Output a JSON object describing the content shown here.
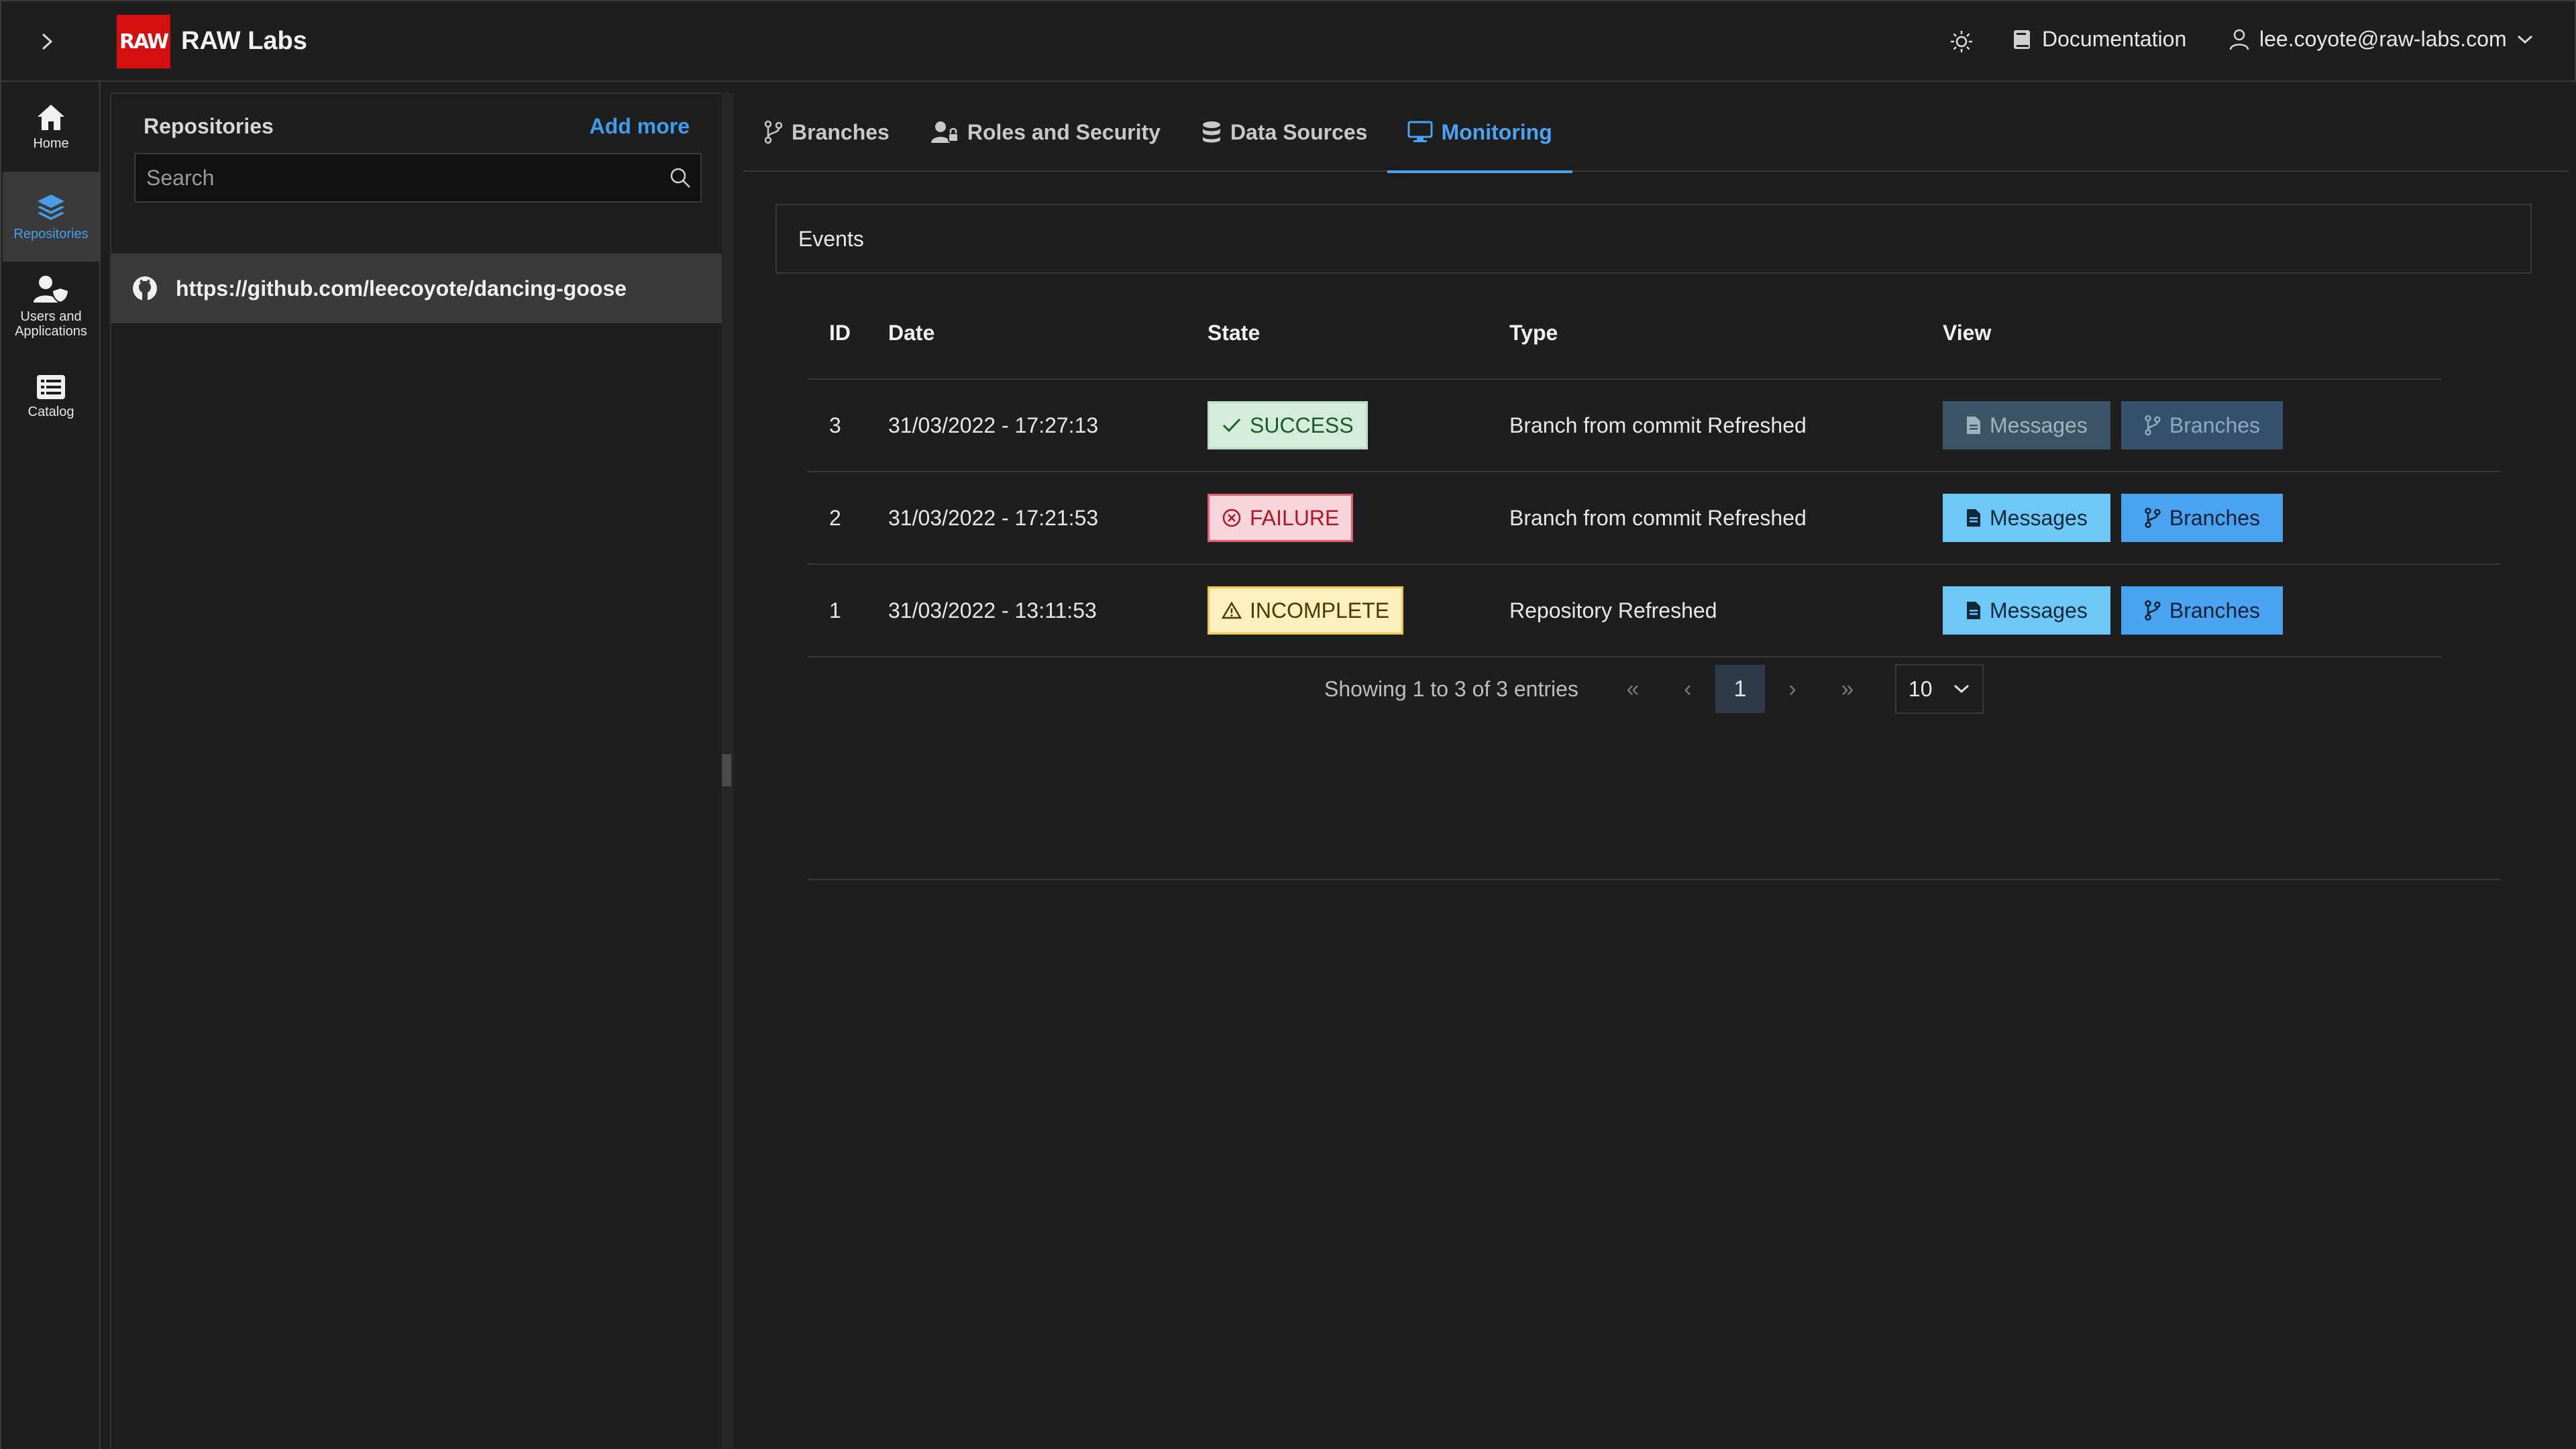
{
  "app": {
    "logo_text": "RAW",
    "brand": "RAW Labs"
  },
  "header": {
    "documentation": "Documentation",
    "user_email": "lee.coyote@raw-labs.com"
  },
  "rail": {
    "items": [
      {
        "label": "Home",
        "icon": "home-icon"
      },
      {
        "label": "Repositories",
        "icon": "layers-icon",
        "active": true
      },
      {
        "label": "Users and Applications",
        "icon": "user-shield-icon"
      },
      {
        "label": "Catalog",
        "icon": "list-icon"
      }
    ]
  },
  "repositories": {
    "title": "Repositories",
    "add_more": "Add more",
    "search_placeholder": "Search",
    "items": [
      {
        "url": "https://github.com/leecoyote/dancing-goose",
        "icon": "github-icon"
      }
    ]
  },
  "tabs": [
    {
      "label": "Branches",
      "icon": "branch-icon"
    },
    {
      "label": "Roles and Security",
      "icon": "user-lock-icon"
    },
    {
      "label": "Data Sources",
      "icon": "database-icon"
    },
    {
      "label": "Monitoring",
      "icon": "monitor-icon",
      "active": true
    }
  ],
  "events": {
    "title": "Events",
    "columns": [
      "ID",
      "Date",
      "State",
      "Type",
      "View"
    ],
    "rows": [
      {
        "id": "3",
        "date": "31/03/2022 - 17:27:13",
        "state": "SUCCESS",
        "type": "Branch from commit Refreshed",
        "messages": "Messages",
        "branches": "Branches"
      },
      {
        "id": "2",
        "date": "31/03/2022 - 17:21:53",
        "state": "FAILURE",
        "type": "Branch from commit Refreshed",
        "messages": "Messages",
        "branches": "Branches"
      },
      {
        "id": "1",
        "date": "31/03/2022 - 13:11:53",
        "state": "INCOMPLETE",
        "type": "Repository Refreshed",
        "messages": "Messages",
        "branches": "Branches"
      }
    ]
  },
  "pagination": {
    "info": "Showing 1 to 3 of 3 entries",
    "first": "«",
    "prev": "‹",
    "current": "1",
    "next": "›",
    "last": "»",
    "page_size": "10"
  },
  "colors": {
    "accent": "#4aa3f0",
    "logo_red": "#d40f0f",
    "success": "#d4edda",
    "failure": "#f7d6db",
    "incomplete": "#fff0c0"
  }
}
